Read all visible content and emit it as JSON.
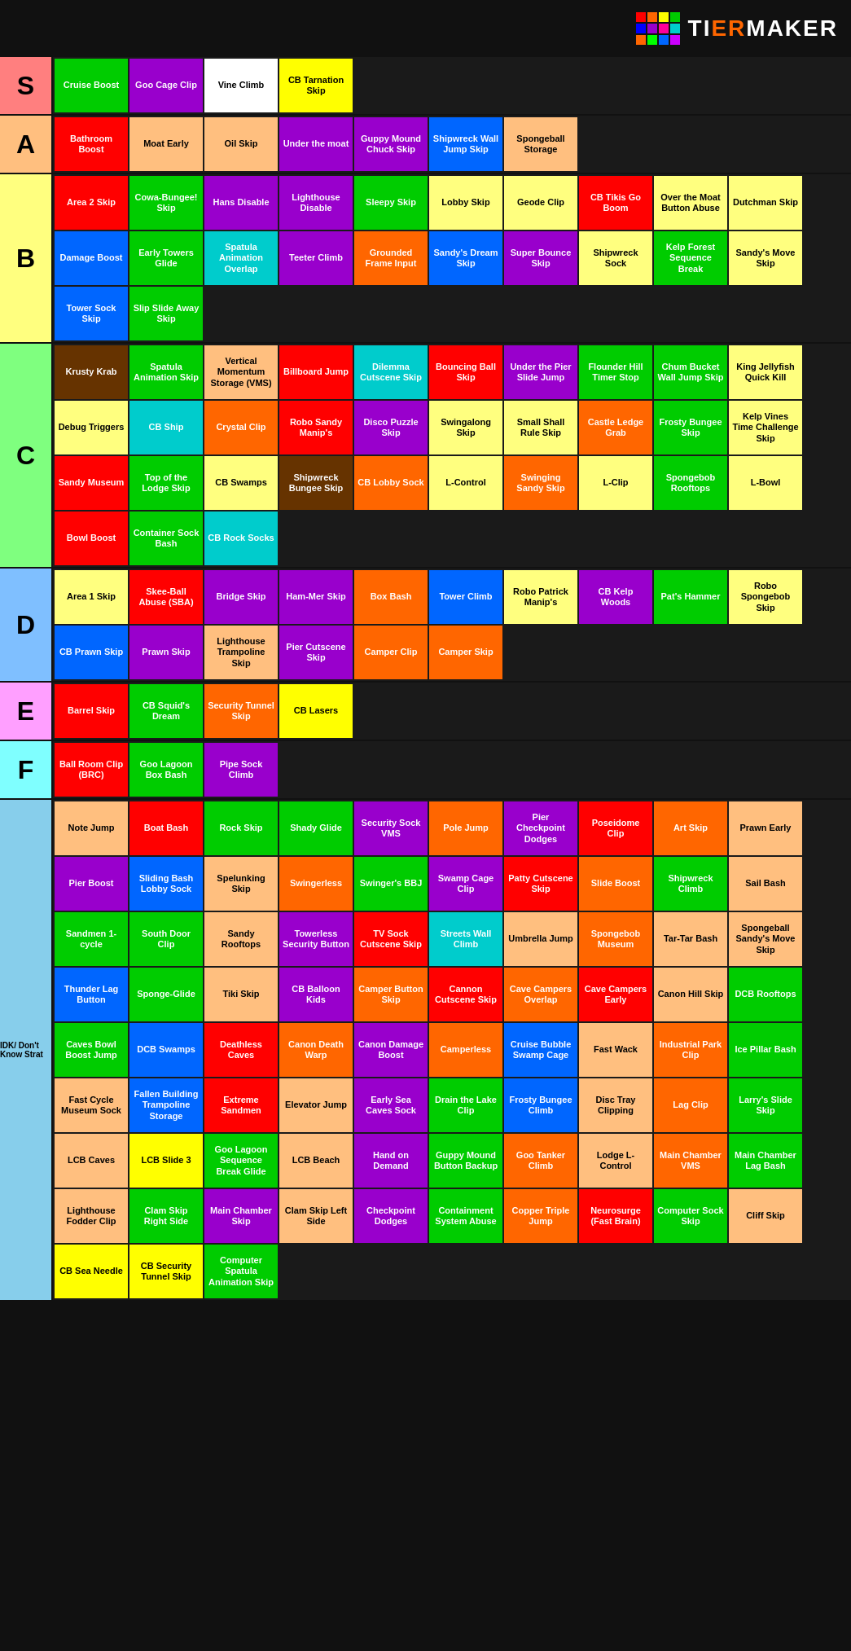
{
  "logo": {
    "text_tier": "Ti",
    "text_er": "ERMAKER",
    "full": "TiERMAKER"
  },
  "logo_colors": [
    "#ff0000",
    "#ff6600",
    "#ffff00",
    "#00cc00",
    "#0000ff",
    "#9900cc",
    "#ff0099",
    "#00cccc",
    "#ff6600",
    "#00ff00",
    "#0066ff",
    "#cc00ff"
  ],
  "tiers": [
    {
      "label": "S",
      "color": "#ff7f7f",
      "items": [
        {
          "text": "Cruise Boost",
          "color": "#00cc00"
        },
        {
          "text": "Goo Cage Clip",
          "color": "#9900cc"
        },
        {
          "text": "Vine Climb",
          "color": "#ffffff",
          "textColor": "#000"
        },
        {
          "text": "CB Tarnation Skip",
          "color": "#ffff00",
          "textColor": "#000"
        }
      ]
    },
    {
      "label": "A",
      "color": "#ffbf7f",
      "items": [
        {
          "text": "Bathroom Boost",
          "color": "#ff0000"
        },
        {
          "text": "Moat Early",
          "color": "#ffbf7f",
          "textColor": "#000"
        },
        {
          "text": "Oil Skip",
          "color": "#ffbf7f",
          "textColor": "#000"
        },
        {
          "text": "Under the moat",
          "color": "#9900cc"
        },
        {
          "text": "Guppy Mound Chuck Skip",
          "color": "#9900cc"
        },
        {
          "text": "Shipwreck Wall Jump Skip",
          "color": "#0066ff"
        },
        {
          "text": "Spongeball Storage",
          "color": "#ffbf7f",
          "textColor": "#000"
        }
      ]
    },
    {
      "label": "B",
      "color": "#ffff7f",
      "items": [
        {
          "text": "Area 2 Skip",
          "color": "#ff0000"
        },
        {
          "text": "Cowa-Bungee! Skip",
          "color": "#00cc00"
        },
        {
          "text": "Hans Disable",
          "color": "#9900cc"
        },
        {
          "text": "Lighthouse Disable",
          "color": "#9900cc"
        },
        {
          "text": "Sleepy Skip",
          "color": "#00cc00"
        },
        {
          "text": "Lobby Skip",
          "color": "#ffff7f",
          "textColor": "#000"
        },
        {
          "text": "Geode Clip",
          "color": "#ffff7f",
          "textColor": "#000"
        },
        {
          "text": "CB Tikis Go Boom",
          "color": "#ff0000"
        },
        {
          "text": "Over the Moat Button Abuse",
          "color": "#ffff7f",
          "textColor": "#000"
        },
        {
          "text": "Dutchman Skip",
          "color": "#ffff7f",
          "textColor": "#000"
        },
        {
          "text": "Damage Boost",
          "color": "#0066ff"
        },
        {
          "text": "Early Towers Glide",
          "color": "#00cc00"
        },
        {
          "text": "Spatula Animation Overlap",
          "color": "#00cccc"
        },
        {
          "text": "Teeter Climb",
          "color": "#9900cc"
        },
        {
          "text": "Grounded Frame Input",
          "color": "#ff6600"
        },
        {
          "text": "Sandy's Dream Skip",
          "color": "#0066ff"
        },
        {
          "text": "Super Bounce Skip",
          "color": "#9900cc"
        },
        {
          "text": "Shipwreck Sock",
          "color": "#ffff7f",
          "textColor": "#000"
        },
        {
          "text": "Kelp Forest Sequence Break",
          "color": "#00cc00"
        },
        {
          "text": "Sandy's Move Skip",
          "color": "#ffff7f",
          "textColor": "#000"
        },
        {
          "text": "Tower Sock Skip",
          "color": "#0066ff"
        },
        {
          "text": "Slip Slide Away Skip",
          "color": "#00cc00"
        }
      ]
    },
    {
      "label": "C",
      "color": "#7fff7f",
      "items": [
        {
          "text": "Krusty Krab",
          "color": "#663300"
        },
        {
          "text": "Spatula Animation Skip",
          "color": "#00cc00"
        },
        {
          "text": "Vertical Momentum Storage (VMS)",
          "color": "#ffbf7f",
          "textColor": "#000"
        },
        {
          "text": "Billboard Jump",
          "color": "#ff0000"
        },
        {
          "text": "Dilemma Cutscene Skip",
          "color": "#00cccc"
        },
        {
          "text": "Bouncing Ball Skip",
          "color": "#ff0000"
        },
        {
          "text": "Under the Pier Slide Jump",
          "color": "#9900cc"
        },
        {
          "text": "Flounder Hill Timer Stop",
          "color": "#00cc00"
        },
        {
          "text": "Chum Bucket Wall Jump Skip",
          "color": "#00cc00"
        },
        {
          "text": "King Jellyfish Quick Kill",
          "color": "#ffff7f",
          "textColor": "#000"
        },
        {
          "text": "Debug Triggers",
          "color": "#ffff7f",
          "textColor": "#000"
        },
        {
          "text": "CB Ship",
          "color": "#00cccc"
        },
        {
          "text": "Crystal Clip",
          "color": "#ff6600"
        },
        {
          "text": "Robo Sandy Manip's",
          "color": "#ff0000"
        },
        {
          "text": "Disco Puzzle Skip",
          "color": "#9900cc"
        },
        {
          "text": "Swingalong Skip",
          "color": "#ffff7f",
          "textColor": "#000"
        },
        {
          "text": "Small Shall Rule Skip",
          "color": "#ffff7f",
          "textColor": "#000"
        },
        {
          "text": "Castle Ledge Grab",
          "color": "#ff6600"
        },
        {
          "text": "Frosty Bungee Skip",
          "color": "#00cc00"
        },
        {
          "text": "Kelp Vines Time Challenge Skip",
          "color": "#ffff7f",
          "textColor": "#000"
        },
        {
          "text": "Sandy Museum",
          "color": "#ff0000"
        },
        {
          "text": "Top of the Lodge Skip",
          "color": "#00cc00"
        },
        {
          "text": "CB Swamps",
          "color": "#ffff7f",
          "textColor": "#000"
        },
        {
          "text": "Shipwreck Bungee Skip",
          "color": "#663300"
        },
        {
          "text": "CB Lobby Sock",
          "color": "#ff6600"
        },
        {
          "text": "L-Control",
          "color": "#ffff7f",
          "textColor": "#000"
        },
        {
          "text": "Swinging Sandy Skip",
          "color": "#ff6600"
        },
        {
          "text": "L-Clip",
          "color": "#ffff7f",
          "textColor": "#000"
        },
        {
          "text": "Spongebob Rooftops",
          "color": "#00cc00"
        },
        {
          "text": "L-Bowl",
          "color": "#ffff7f",
          "textColor": "#000"
        },
        {
          "text": "Bowl Boost",
          "color": "#ff0000"
        },
        {
          "text": "Container Sock Bash",
          "color": "#00cc00"
        },
        {
          "text": "CB Rock Socks",
          "color": "#00cccc"
        }
      ]
    },
    {
      "label": "D",
      "color": "#7fbfff",
      "items": [
        {
          "text": "Area 1 Skip",
          "color": "#ffff7f",
          "textColor": "#000"
        },
        {
          "text": "Skee-Ball Abuse (SBA)",
          "color": "#ff0000"
        },
        {
          "text": "Bridge Skip",
          "color": "#9900cc"
        },
        {
          "text": "Ham-Mer Skip",
          "color": "#9900cc"
        },
        {
          "text": "Box Bash",
          "color": "#ff6600"
        },
        {
          "text": "Tower Climb",
          "color": "#0066ff"
        },
        {
          "text": "Robo Patrick Manip's",
          "color": "#ffff7f",
          "textColor": "#000"
        },
        {
          "text": "CB Kelp Woods",
          "color": "#9900cc"
        },
        {
          "text": "Pat's Hammer",
          "color": "#00cc00"
        },
        {
          "text": "Robo Spongebob Skip",
          "color": "#ffff7f",
          "textColor": "#000"
        },
        {
          "text": "CB Prawn Skip",
          "color": "#0066ff"
        },
        {
          "text": "Prawn Skip",
          "color": "#9900cc"
        },
        {
          "text": "Lighthouse Trampoline Skip",
          "color": "#ffbf7f",
          "textColor": "#000"
        },
        {
          "text": "Pier Cutscene Skip",
          "color": "#9900cc"
        },
        {
          "text": "Camper Clip",
          "color": "#ff6600"
        },
        {
          "text": "Camper Skip",
          "color": "#ff6600"
        }
      ]
    },
    {
      "label": "E",
      "color": "#ff9fff",
      "items": [
        {
          "text": "Barrel Skip",
          "color": "#ff0000"
        },
        {
          "text": "CB Squid's Dream",
          "color": "#00cc00"
        },
        {
          "text": "Security Tunnel Skip",
          "color": "#ff6600"
        },
        {
          "text": "CB Lasers",
          "color": "#ffff00",
          "textColor": "#000"
        }
      ]
    },
    {
      "label": "F",
      "color": "#7fffff",
      "items": [
        {
          "text": "Ball Room Clip (BRC)",
          "color": "#ff0000"
        },
        {
          "text": "Goo Lagoon Box Bash",
          "color": "#00cc00"
        },
        {
          "text": "Pipe Sock Climb",
          "color": "#9900cc"
        }
      ]
    },
    {
      "label": "IDK/ Don't Know Strat",
      "color": "#87ceeb",
      "labelSize": "10px",
      "items": [
        {
          "text": "Note Jump",
          "color": "#ffbf7f",
          "textColor": "#000"
        },
        {
          "text": "Boat Bash",
          "color": "#ff0000"
        },
        {
          "text": "Rock Skip",
          "color": "#00cc00"
        },
        {
          "text": "Shady Glide",
          "color": "#00cc00"
        },
        {
          "text": "Security Sock VMS",
          "color": "#9900cc"
        },
        {
          "text": "Pole Jump",
          "color": "#ff6600"
        },
        {
          "text": "Pier Checkpoint Dodges",
          "color": "#9900cc"
        },
        {
          "text": "Poseidome Clip",
          "color": "#ff0000"
        },
        {
          "text": "Art Skip",
          "color": "#ff6600"
        },
        {
          "text": "Prawn Early",
          "color": "#ffbf7f",
          "textColor": "#000"
        },
        {
          "text": "Pier Boost",
          "color": "#9900cc"
        },
        {
          "text": "Sliding Bash Lobby Sock",
          "color": "#0066ff"
        },
        {
          "text": "Spelunking Skip",
          "color": "#ffbf7f",
          "textColor": "#000"
        },
        {
          "text": "Swingerless",
          "color": "#ff6600"
        },
        {
          "text": "Swinger's BBJ",
          "color": "#00cc00"
        },
        {
          "text": "Swamp Cage Clip",
          "color": "#9900cc"
        },
        {
          "text": "Patty Cutscene Skip",
          "color": "#ff0000"
        },
        {
          "text": "Slide Boost",
          "color": "#ff6600"
        },
        {
          "text": "Shipwreck Climb",
          "color": "#00cc00"
        },
        {
          "text": "Sail Bash",
          "color": "#ffbf7f",
          "textColor": "#000"
        },
        {
          "text": "Sandmen 1-cycle",
          "color": "#00cc00"
        },
        {
          "text": "South Door Clip",
          "color": "#00cc00"
        },
        {
          "text": "Sandy Rooftops",
          "color": "#ffbf7f",
          "textColor": "#000"
        },
        {
          "text": "Towerless Security Button",
          "color": "#9900cc"
        },
        {
          "text": "TV Sock Cutscene Skip",
          "color": "#ff0000"
        },
        {
          "text": "Streets Wall Climb",
          "color": "#00cccc"
        },
        {
          "text": "Umbrella Jump",
          "color": "#ffbf7f",
          "textColor": "#000"
        },
        {
          "text": "Spongebob Museum",
          "color": "#ff6600"
        },
        {
          "text": "Tar-Tar Bash",
          "color": "#ffbf7f",
          "textColor": "#000"
        },
        {
          "text": "Spongeball Sandy's Move Skip",
          "color": "#ffbf7f",
          "textColor": "#000"
        },
        {
          "text": "Thunder Lag Button",
          "color": "#0066ff"
        },
        {
          "text": "Sponge-Glide",
          "color": "#00cc00"
        },
        {
          "text": "Tiki Skip",
          "color": "#ffbf7f",
          "textColor": "#000"
        },
        {
          "text": "CB Balloon Kids",
          "color": "#9900cc"
        },
        {
          "text": "Camper Button Skip",
          "color": "#ff6600"
        },
        {
          "text": "Cannon Cutscene Skip",
          "color": "#ff0000"
        },
        {
          "text": "Cave Campers Overlap",
          "color": "#ff6600"
        },
        {
          "text": "Cave Campers Early",
          "color": "#ff0000"
        },
        {
          "text": "Canon Hill Skip",
          "color": "#ffbf7f",
          "textColor": "#000"
        },
        {
          "text": "DCB Rooftops",
          "color": "#00cc00"
        },
        {
          "text": "Caves Bowl Boost Jump",
          "color": "#00cc00"
        },
        {
          "text": "DCB Swamps",
          "color": "#0066ff"
        },
        {
          "text": "Deathless Caves",
          "color": "#ff0000"
        },
        {
          "text": "Canon Death Warp",
          "color": "#ff6600"
        },
        {
          "text": "Canon Damage Boost",
          "color": "#9900cc"
        },
        {
          "text": "Camperless",
          "color": "#ff6600"
        },
        {
          "text": "Cruise Bubble Swamp Cage",
          "color": "#0066ff"
        },
        {
          "text": "Fast Wack",
          "color": "#ffbf7f",
          "textColor": "#000"
        },
        {
          "text": "Industrial Park Clip",
          "color": "#ff6600"
        },
        {
          "text": "Ice Pillar Bash",
          "color": "#00cc00"
        },
        {
          "text": "Fast Cycle Museum Sock",
          "color": "#ffbf7f",
          "textColor": "#000"
        },
        {
          "text": "Fallen Building Trampoline Storage",
          "color": "#0066ff"
        },
        {
          "text": "Extreme Sandmen",
          "color": "#ff0000"
        },
        {
          "text": "Elevator Jump",
          "color": "#ffbf7f",
          "textColor": "#000"
        },
        {
          "text": "Early Sea Caves Sock",
          "color": "#9900cc"
        },
        {
          "text": "Drain the Lake Clip",
          "color": "#00cc00"
        },
        {
          "text": "Frosty Bungee Climb",
          "color": "#0066ff"
        },
        {
          "text": "Disc Tray Clipping",
          "color": "#ffbf7f",
          "textColor": "#000"
        },
        {
          "text": "Lag Clip",
          "color": "#ff6600"
        },
        {
          "text": "Larry's Slide Skip",
          "color": "#00cc00"
        },
        {
          "text": "LCB Caves",
          "color": "#ffbf7f",
          "textColor": "#000"
        },
        {
          "text": "LCB Slide 3",
          "color": "#ffff00",
          "textColor": "#000"
        },
        {
          "text": "Goo Lagoon Sequence Break Glide",
          "color": "#00cc00"
        },
        {
          "text": "LCB Beach",
          "color": "#ffbf7f",
          "textColor": "#000"
        },
        {
          "text": "Hand on Demand",
          "color": "#9900cc"
        },
        {
          "text": "Guppy Mound Button Backup",
          "color": "#00cc00"
        },
        {
          "text": "Goo Tanker Climb",
          "color": "#ff6600"
        },
        {
          "text": "Lodge L-Control",
          "color": "#ffbf7f",
          "textColor": "#000"
        },
        {
          "text": "Main Chamber VMS",
          "color": "#ff6600"
        },
        {
          "text": "Main Chamber Lag Bash",
          "color": "#00cc00"
        },
        {
          "text": "Lighthouse Fodder Clip",
          "color": "#ffbf7f",
          "textColor": "#000"
        },
        {
          "text": "Clam Skip Right Side",
          "color": "#00cc00"
        },
        {
          "text": "Main Chamber Skip",
          "color": "#9900cc"
        },
        {
          "text": "Clam Skip Left Side",
          "color": "#ffbf7f",
          "textColor": "#000"
        },
        {
          "text": "Checkpoint Dodges",
          "color": "#9900cc"
        },
        {
          "text": "Containment System Abuse",
          "color": "#00cc00"
        },
        {
          "text": "Copper Triple Jump",
          "color": "#ff6600"
        },
        {
          "text": "Neurosurge (Fast Brain)",
          "color": "#ff0000"
        },
        {
          "text": "Computer Sock Skip",
          "color": "#00cc00"
        },
        {
          "text": "Cliff Skip",
          "color": "#ffbf7f",
          "textColor": "#000"
        },
        {
          "text": "CB Sea Needle",
          "color": "#ffff00",
          "textColor": "#000"
        },
        {
          "text": "CB Security Tunnel Skip",
          "color": "#ffff00",
          "textColor": "#000"
        },
        {
          "text": "Computer Spatula Animation Skip",
          "color": "#00cc00"
        }
      ]
    }
  ]
}
